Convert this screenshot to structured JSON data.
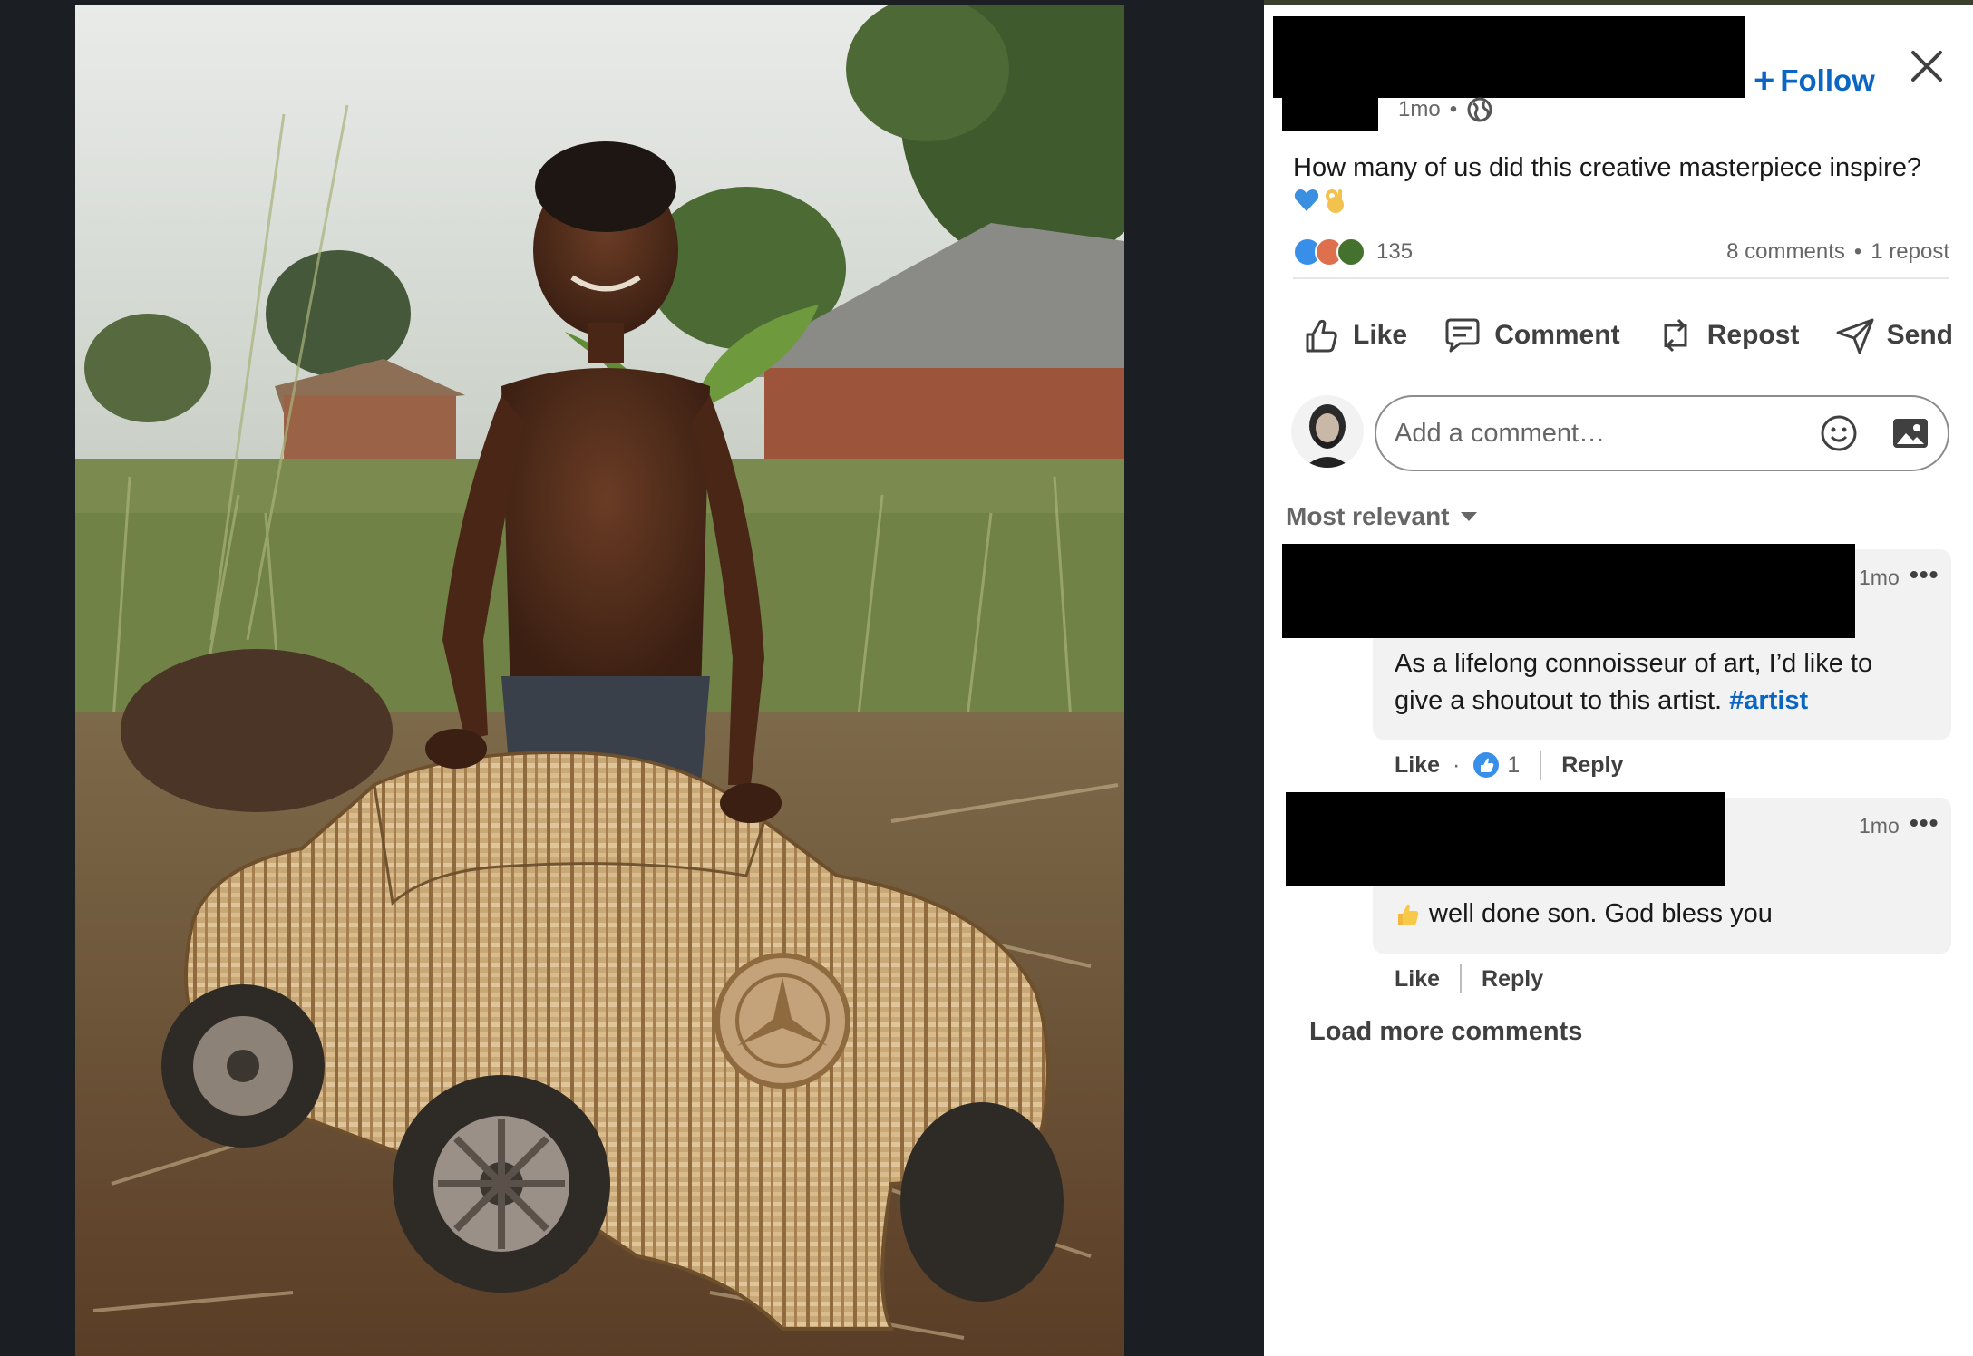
{
  "post": {
    "follow_label": "Follow",
    "follow_plus": "+",
    "time": "1mo",
    "meta_dot": "•",
    "text": "How many of us did this creative masterpiece inspire?",
    "reaction_count": "135",
    "comments_count": "8 comments",
    "repost_count": "1 repost",
    "stats_dot": "•"
  },
  "actions": {
    "like": "Like",
    "comment": "Comment",
    "repost": "Repost",
    "send": "Send"
  },
  "composer": {
    "placeholder": "Add a comment…"
  },
  "sort": {
    "label": "Most relevant"
  },
  "comments": [
    {
      "time": "1mo",
      "more": "•••",
      "text": "As a lifelong connoisseur of art, I’d like to give a shoutout to this artist.",
      "hashtag": "#artist",
      "like": "Like",
      "dot": "·",
      "reaction_count": "1",
      "reply": "Reply"
    },
    {
      "time": "1mo",
      "more": "•••",
      "text": "well done son. God bless you",
      "like": "Like",
      "reply": "Reply"
    }
  ],
  "load_more": "Load more comments",
  "icons": [
    "close-icon",
    "globe-icon",
    "blue-heart-emoji",
    "ok-hand-emoji",
    "like-icon",
    "comment-icon",
    "repost-icon",
    "send-icon",
    "smiley-icon",
    "image-icon",
    "caret-down-icon",
    "thumbs-up-emoji",
    "more-icon"
  ],
  "colors": {
    "accent": "#0a66c2",
    "viewer_bg": "#1b1f23",
    "bubble_bg": "#f2f2f2",
    "redaction": "#000000"
  }
}
